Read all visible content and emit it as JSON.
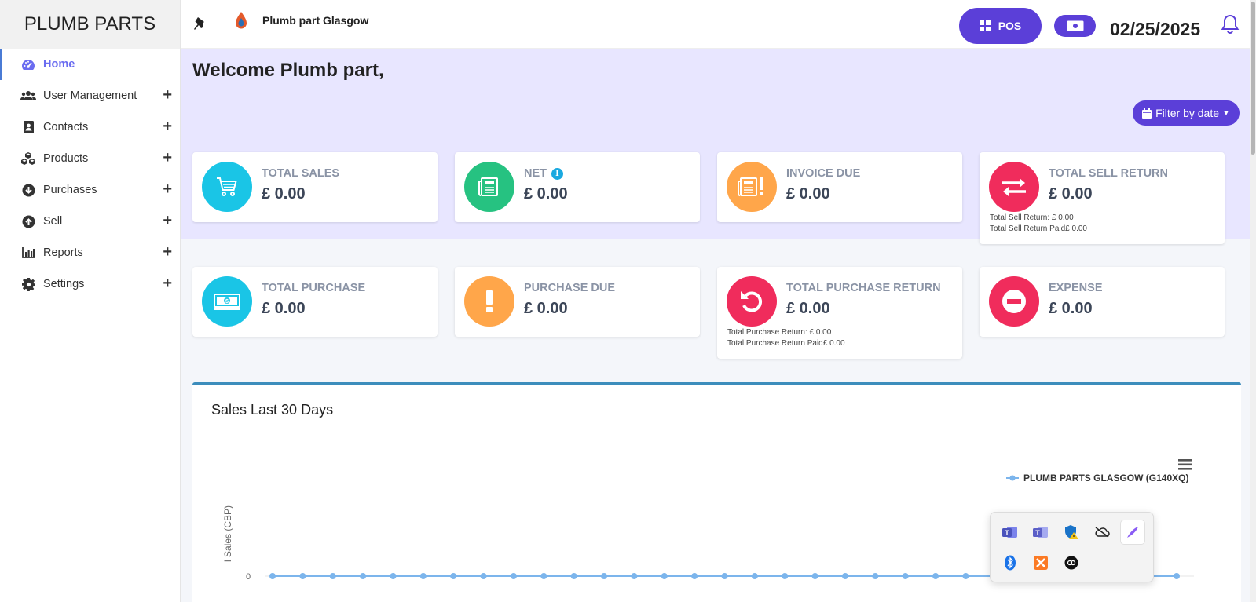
{
  "brand": "PLUMB PARTS",
  "sidebar": {
    "items": [
      {
        "label": "Home",
        "icon": "dashboard-icon",
        "active": true,
        "expandable": false
      },
      {
        "label": "User Management",
        "icon": "users-icon",
        "expandable": true
      },
      {
        "label": "Contacts",
        "icon": "address-book-icon",
        "expandable": true
      },
      {
        "label": "Products",
        "icon": "cubes-icon",
        "expandable": true
      },
      {
        "label": "Purchases",
        "icon": "arrow-circle-down-icon",
        "expandable": true
      },
      {
        "label": "Sell",
        "icon": "arrow-circle-up-icon",
        "expandable": true
      },
      {
        "label": "Reports",
        "icon": "bar-chart-icon",
        "expandable": true
      },
      {
        "label": "Settings",
        "icon": "gear-icon",
        "expandable": true
      }
    ],
    "plus_symbol": "+"
  },
  "topbar": {
    "business_name": "Plumb part Glasgow",
    "pos_label": "POS",
    "date": "02/25/2025"
  },
  "welcome": "Welcome Plumb part,",
  "filter_label": "Filter by date",
  "cards_row1": [
    {
      "label": "TOTAL SALES",
      "value": "£ 0.00",
      "color": "#1ac5e6",
      "icon": "cart-icon"
    },
    {
      "label": "NET",
      "value": "£ 0.00",
      "color": "#26c281",
      "icon": "newspaper-icon",
      "info": "i"
    },
    {
      "label": "INVOICE DUE",
      "value": "£ 0.00",
      "color": "#ffa64a",
      "icon": "invoice-warning-icon"
    },
    {
      "label": "TOTAL SELL RETURN",
      "value": "£ 0.00",
      "color": "#f02c5c",
      "icon": "exchange-icon",
      "sub1": "Total Sell Return: £ 0.00",
      "sub2": "Total Sell Return Paid£ 0.00"
    }
  ],
  "cards_row2": [
    {
      "label": "TOTAL PURCHASE",
      "value": "£ 0.00",
      "color": "#1ac5e6",
      "icon": "money-icon"
    },
    {
      "label": "PURCHASE DUE",
      "value": "£ 0.00",
      "color": "#ffa64a",
      "icon": "exclamation-icon"
    },
    {
      "label": "TOTAL PURCHASE RETURN",
      "value": "£ 0.00",
      "color": "#f02c5c",
      "icon": "undo-icon",
      "sub1": "Total Purchase Return: £ 0.00",
      "sub2": "Total Purchase Return Paid£ 0.00"
    },
    {
      "label": "EXPENSE",
      "value": "£ 0.00",
      "color": "#f02c5c",
      "icon": "minus-circle-icon"
    }
  ],
  "chart_panel": {
    "title": "Sales Last 30 Days",
    "ylabel_visible": "l Sales (CBP)",
    "legend": "PLUMB PARTS GLASGOW (G140XQ)"
  },
  "chart_data": {
    "type": "line",
    "title": "Sales Last 30 Days",
    "ylabel": "l Sales (CBP)",
    "series": [
      {
        "name": "PLUMB PARTS GLASGOW (G140XQ)",
        "color": "#7cb5ec",
        "values": [
          0,
          0,
          0,
          0,
          0,
          0,
          0,
          0,
          0,
          0,
          0,
          0,
          0,
          0,
          0,
          0,
          0,
          0,
          0,
          0,
          0,
          0,
          0,
          0,
          0,
          0,
          0,
          0,
          0,
          0,
          0
        ]
      }
    ],
    "yticks": [
      "0"
    ],
    "legend_position": "top-right"
  },
  "tray": {
    "icons": [
      "teams-icon",
      "teams-classic-icon",
      "windows-security-icon",
      "onedrive-icon",
      "pen-icon",
      "bluetooth-icon",
      "xampp-icon",
      "app-icon"
    ]
  },
  "colors": {
    "accent": "#5b3fd8",
    "hero": "#e8e6ff",
    "chart_line": "#7cb5ec"
  }
}
